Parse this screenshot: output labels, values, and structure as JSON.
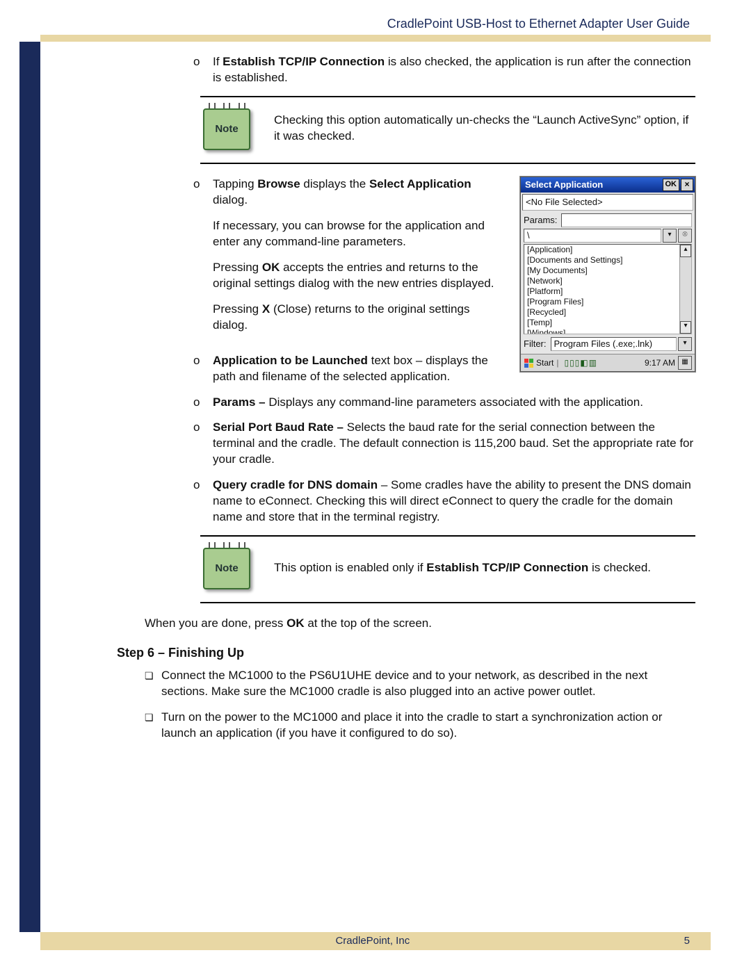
{
  "header_title": "CradlePoint USB-Host to Ethernet Adapter User Guide",
  "footer": {
    "company": "CradlePoint, Inc",
    "page_no": "5"
  },
  "bullets": {
    "b0_pre": "If ",
    "b0_bold": "Establish TCP/IP Connection",
    "b0_post": " is also checked, the application is run after the connection is established.",
    "note1": "Checking this option automatically un-checks the “Launch ActiveSync” option, if it was checked.",
    "b1_a": "Tapping ",
    "b1_b": "Browse",
    "b1_c": " displays the ",
    "b1_d": "Select Application",
    "b1_e": " dialog.",
    "b1_p2": "If necessary, you can browse for the application and enter any command-line parameters.",
    "b1_p3a": "Pressing ",
    "b1_p3b": "OK",
    "b1_p3c": " accepts the entries and returns to the original settings dialog with the new entries displayed.",
    "b1_p4a": "Pressing ",
    "b1_p4b": "X",
    "b1_p4c": " (Close) returns to the original settings dialog.",
    "b2_bold": "Application to be Launched",
    "b2_post": " text box – displays the path and filename of the selected application.",
    "b3_bold": "Params – ",
    "b3_post": "Displays any command-line parameters associated with the application.",
    "b4_bold": "Serial Port Baud Rate – ",
    "b4_post": "Selects the baud rate for the serial connection between the terminal and the cradle. The default connection is 115,200 baud. Set the appropriate rate for your cradle.",
    "b5_bold": "Query cradle for DNS domain",
    "b5_post": " – Some cradles have the ability to present the DNS domain name to eConnect. Checking this will direct eConnect to query the cradle for the domain name and store that in the terminal registry.",
    "note2_a": "This option is enabled only if ",
    "note2_b": "Establish TCP/IP Connection",
    "note2_c": " is checked.",
    "done_a": "When you are done, press ",
    "done_b": "OK",
    "done_c": " at the top of the screen."
  },
  "note_label": "Note",
  "step6_title": "Step 6 – Finishing Up",
  "step6_items": {
    "i0": "Connect the MC1000 to the PS6U1UHE device and to your network, as described in the next sections. Make sure the MC1000 cradle is also plugged into an active power outlet.",
    "i1": "Turn on the power to the MC1000 and place it into the cradle to start a synchronization action or launch an application (if you have it configured to do so)."
  },
  "dialog": {
    "title": "Select Application",
    "ok": "OK",
    "close": "×",
    "no_file": "<No File Selected>",
    "params_label": "Params:",
    "path": "\\",
    "dirs": [
      "[Application]",
      "[Documents and Settings]",
      "[My Documents]",
      "[Network]",
      "[Platform]",
      "[Program Files]",
      "[Recycled]",
      "[Temp]",
      "[Windows]"
    ],
    "filter_label": "Filter:",
    "filter_value": "Program Files (.exe;.lnk)",
    "start": "Start",
    "clock": "9:17 AM"
  }
}
